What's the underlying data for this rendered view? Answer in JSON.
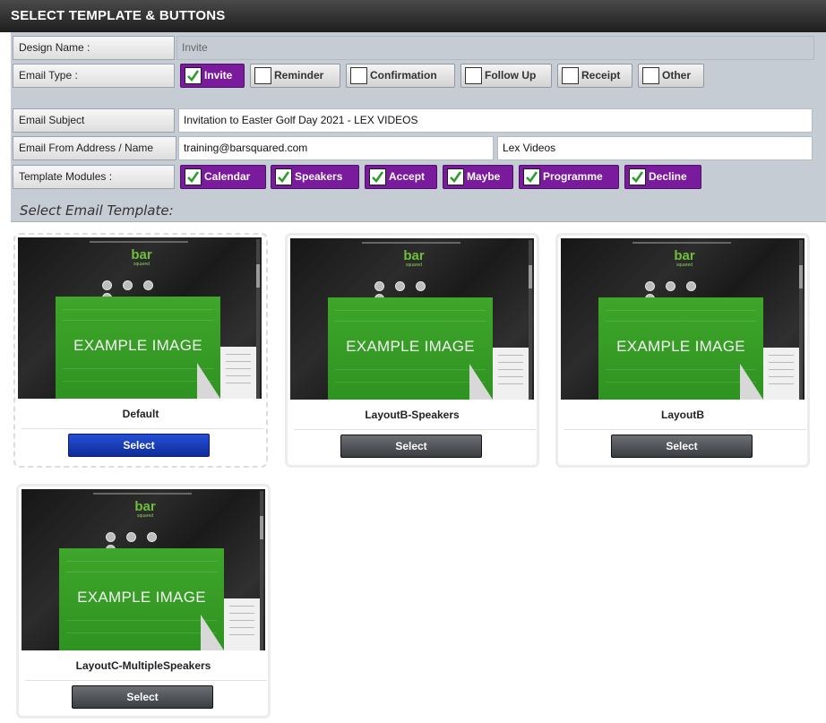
{
  "title": "SELECT TEMPLATE & BUTTONS",
  "form": {
    "design_name": {
      "label": "Design Name :",
      "value": "Invite"
    },
    "email_type": {
      "label": "Email Type :",
      "options": [
        {
          "label": "Invite",
          "checked": true
        },
        {
          "label": "Reminder",
          "checked": false
        },
        {
          "label": "Confirmation",
          "checked": false
        },
        {
          "label": "Follow Up",
          "checked": false
        },
        {
          "label": "Receipt",
          "checked": false
        },
        {
          "label": "Other",
          "checked": false
        }
      ]
    },
    "email_subject": {
      "label": "Email Subject",
      "value": "Invitation to Easter Golf Day 2021 - LEX VIDEOS"
    },
    "email_from": {
      "label": "Email From Address / Name",
      "address": "training@barsquared.com",
      "name": "Lex Videos"
    },
    "template_modules": {
      "label": "Template Modules :",
      "options": [
        {
          "label": "Calendar",
          "checked": true
        },
        {
          "label": "Speakers",
          "checked": true
        },
        {
          "label": "Accept",
          "checked": true
        },
        {
          "label": "Maybe",
          "checked": true
        },
        {
          "label": "Programme",
          "checked": true
        },
        {
          "label": "Decline",
          "checked": true
        }
      ]
    }
  },
  "templates_heading": "Select Email Template:",
  "templates": [
    {
      "name": "Default",
      "button": "Select",
      "selected": true,
      "logo": "bar",
      "logo_sub": "squared",
      "image_text": "EXAMPLE IMAGE"
    },
    {
      "name": "LayoutB-Speakers",
      "button": "Select",
      "selected": false,
      "logo": "bar",
      "logo_sub": "squared",
      "image_text": "EXAMPLE IMAGE"
    },
    {
      "name": "LayoutB",
      "button": "Select",
      "selected": false,
      "logo": "bar",
      "logo_sub": "squared",
      "image_text": "EXAMPLE IMAGE"
    },
    {
      "name": "LayoutC-MultipleSpeakers",
      "button": "Select",
      "selected": false,
      "logo": "bar",
      "logo_sub": "squared",
      "image_text": "EXAMPLE IMAGE"
    }
  ],
  "colors": {
    "checked_bg": "#7a1a9c",
    "selected_button": "#1a3fc0",
    "panel_bg": "#c6ccd4",
    "title_bg": "#2b2b2b"
  },
  "icons": [
    "check-icon",
    "home-icon",
    "twitter-icon",
    "rss-icon",
    "plus-icon"
  ]
}
